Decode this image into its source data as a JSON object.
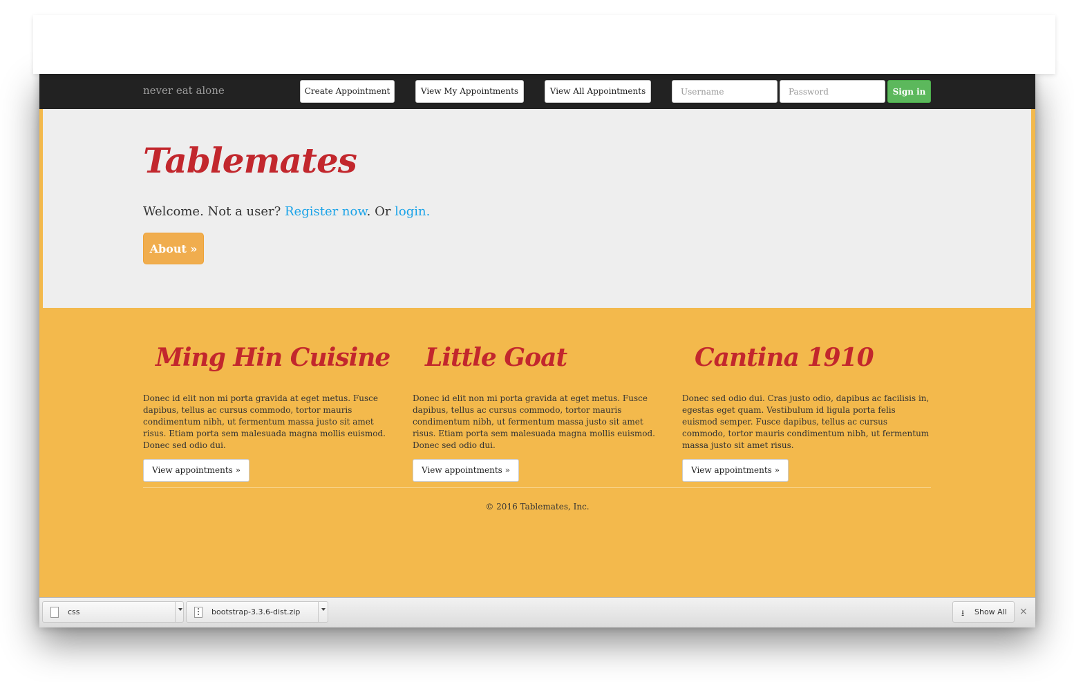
{
  "navbar": {
    "brand": "never eat alone",
    "buttons": [
      "Create Appointment",
      "View My Appointments",
      "View All Appointments"
    ],
    "username_placeholder": "Username",
    "password_placeholder": "Password",
    "signin_label": "Sign in"
  },
  "hero": {
    "title": "Tablemates",
    "welcome_prefix": "Welcome. Not a user? ",
    "register_link": "Register now",
    "middle": ". Or ",
    "login_link": "login.",
    "about_label": "About »"
  },
  "restaurants": [
    {
      "name": "Ming Hin Cuisine",
      "text": "Donec id elit non mi porta gravida at eget metus. Fusce dapibus, tellus ac cursus commodo, tortor mauris condimentum nibh, ut fermentum massa justo sit amet risus. Etiam porta sem malesuada magna mollis euismod. Donec sed odio dui.",
      "button": "View appointments »"
    },
    {
      "name": "Little Goat",
      "text": "Donec id elit non mi porta gravida at eget metus. Fusce dapibus, tellus ac cursus commodo, tortor mauris condimentum nibh, ut fermentum massa justo sit amet risus. Etiam porta sem malesuada magna mollis euismod. Donec sed odio dui.",
      "button": "View appointments »"
    },
    {
      "name": "Cantina 1910",
      "text": "Donec sed odio dui. Cras justo odio, dapibus ac facilisis in, egestas eget quam. Vestibulum id ligula porta felis euismod semper. Fusce dapibus, tellus ac cursus commodo, tortor mauris condimentum nibh, ut fermentum massa justo sit amet risus.",
      "button": "View appointments »"
    }
  ],
  "footer": "© 2016 Tablemates, Inc.",
  "downloads": {
    "items": [
      {
        "name": "css",
        "icon": "file-icon"
      },
      {
        "name": "bootstrap-3.3.6-dist.zip",
        "icon": "zip-file-icon"
      }
    ],
    "show_all": "Show All",
    "close": "×"
  },
  "colors": {
    "accent_red": "#c2272d",
    "page_yellow": "#f3b94c",
    "navbar": "#222222",
    "link_blue": "#1aa3e8",
    "signin_green": "#5cb85c",
    "about_orange": "#f0ad4e"
  }
}
